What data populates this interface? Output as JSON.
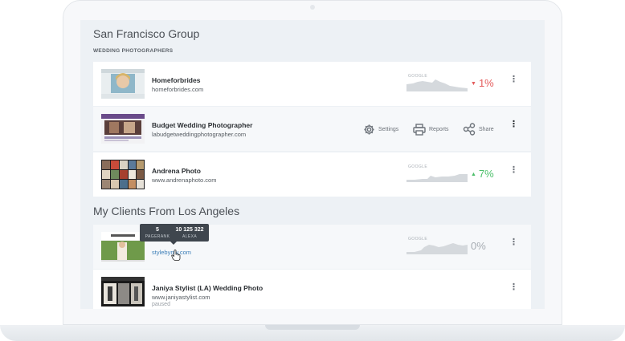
{
  "groups": [
    {
      "title": "San Francisco Group",
      "subtitle": "WEDDING PHOTOGRAPHERS",
      "sites": [
        {
          "name": "Homeforbrides",
          "url": "homeforbrides.com",
          "spark_label": "GOOGLE",
          "change": "1%",
          "trend": "down"
        },
        {
          "name": "Budget Wedding Photographer",
          "url": "labudgetweddingphotographer.com",
          "actions": {
            "settings": "Settings",
            "reports": "Reports",
            "share": "Share"
          }
        },
        {
          "name": "Andrena Photo",
          "url": "www.andrenaphoto.com",
          "spark_label": "GOOGLE",
          "change": "7%",
          "trend": "up"
        }
      ]
    },
    {
      "title": "My Clients From Los Angeles",
      "sites": [
        {
          "url": "stylebymy.com",
          "spark_label": "GOOGLE",
          "change": "0%",
          "trend": "flat",
          "tooltip": {
            "pagerank_value": "5",
            "pagerank_label": "PAGERANK",
            "alexa_value": "10 125 322",
            "alexa_label": "ALEXA"
          }
        },
        {
          "name": "Janiya Stylist (LA) Wedding Photo",
          "url": "www.janiyastylist.com",
          "status": "paused"
        }
      ]
    }
  ],
  "icons": {
    "up_arrow": "▲",
    "down_arrow": "▼",
    "more": "⋮"
  },
  "colors": {
    "accent_link": "#3d7fb8",
    "trend_down": "#e45b5b",
    "trend_up": "#4cbf6a",
    "trend_flat": "#a6acb2"
  }
}
